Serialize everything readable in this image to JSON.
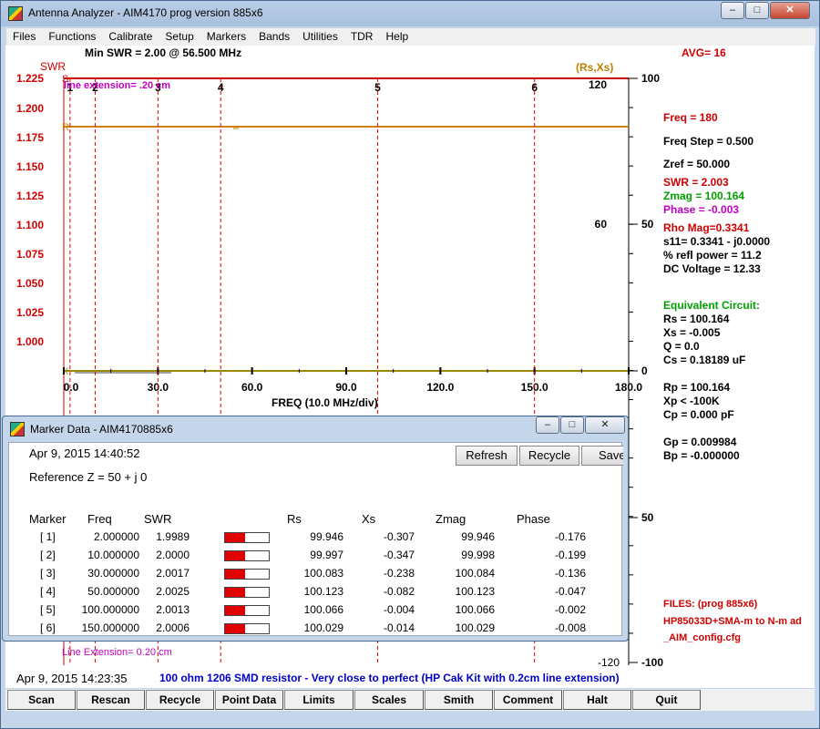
{
  "window": {
    "title": "Antenna Analyzer - AIM4170    prog version 885x6"
  },
  "menu": [
    "Files",
    "Functions",
    "Calibrate",
    "Setup",
    "Markers",
    "Bands",
    "Utilities",
    "TDR",
    "Help"
  ],
  "header": {
    "min_swr": "Min SWR =   2.00 @  56.500 MHz",
    "avg": "AVG=  16",
    "swr_label": "SWR",
    "rsxs_label": "(Rs,Xs)"
  },
  "chart_data": {
    "type": "line",
    "xlabel": "FREQ (10.0 MHz/div)",
    "x_ticks": [
      "0.0",
      "30.0",
      "60.0",
      "90.0",
      "120.0",
      "150.0",
      "180.0"
    ],
    "xlim": [
      0,
      180
    ],
    "swr_ticks": [
      "1.225",
      "1.200",
      "1.175",
      "1.150",
      "1.125",
      "1.100",
      "1.075",
      "1.050",
      "1.025",
      "1.000"
    ],
    "rs_ticks": [
      "120",
      "60"
    ],
    "xs_ticks": [
      "100",
      "50",
      "0",
      "50",
      "-100"
    ],
    "xs_bottom_tick": "-120",
    "markers": [
      "1",
      "2",
      "3",
      "4",
      "5",
      "6"
    ],
    "marker_freqs": [
      2,
      10,
      30,
      50,
      100,
      150
    ],
    "series": [
      {
        "name": "S",
        "values": [
          2.0,
          2.0
        ]
      },
      {
        "name": "R",
        "values": [
          100.0,
          100.0
        ]
      },
      {
        "name": "X",
        "values": [
          0,
          0
        ]
      }
    ],
    "line_extension_top": "line extension=  .20 cm",
    "line_extension_bottom": "Line Extension= 0.20 cm"
  },
  "side": {
    "freq": "Freq = 180",
    "freq_step": "Freq Step = 0.500",
    "zref": "Zref =   50.000",
    "swr": "SWR  =   2.003",
    "zmag": "Zmag = 100.164",
    "phase": "Phase =  -0.003",
    "rho": "Rho Mag=0.3341",
    "s11": "s11= 0.3341 - j0.0000",
    "refl": "% refl power = 11.2",
    "dcv": "DC Voltage  =  12.33",
    "eq_title": "Equivalent Circuit:",
    "rs": "Rs =  100.164",
    "xs": "Xs =  -0.005",
    "q": "Q =  0.0",
    "cs": "Cs =   0.18189  uF",
    "rp": "Rp =  100.164",
    "xp": "Xp < -100K",
    "cp": "Cp =     0.000  pF",
    "gp": "Gp =  0.009984",
    "bp": "Bp = -0.000000",
    "files_title": "FILES:  (prog 885x6)",
    "file1": "HP85033D+SMA-m to N-m ad",
    "file2": "_AIM_config.cfg"
  },
  "status": {
    "datetime": "Apr 9, 2015   14:23:35",
    "comment": "100 ohm 1206 SMD resistor - Very close to perfect (HP Cak Kit with 0.2cm line extension)"
  },
  "buttons": [
    "Scan",
    "Rescan",
    "Recycle",
    "Point Data",
    "Limits",
    "Scales",
    "Smith",
    "Comment",
    "Halt",
    "Quit"
  ],
  "dialog": {
    "title": "Marker Data -  AIM4170885x6",
    "datetime": "Apr 9, 2015   14:40:52",
    "refz": "Reference Z = 50   + j 0",
    "btn_refresh": "Refresh",
    "btn_recycle": "Recycle",
    "btn_save": "Save",
    "headers": [
      "Marker",
      "Freq",
      "SWR",
      "Rs",
      "Xs",
      "Zmag",
      "Phase"
    ],
    "rows": [
      {
        "m": "[ 1]",
        "f": "2.000000",
        "swr": "1.9989",
        "rs": "99.946",
        "xs": "-0.307",
        "zmag": "99.946",
        "ph": "-0.176",
        "bar": 0.45
      },
      {
        "m": "[ 2]",
        "f": "10.000000",
        "swr": "2.0000",
        "rs": "99.997",
        "xs": "-0.347",
        "zmag": "99.998",
        "ph": "-0.199",
        "bar": 0.45
      },
      {
        "m": "[ 3]",
        "f": "30.000000",
        "swr": "2.0017",
        "rs": "100.083",
        "xs": "-0.238",
        "zmag": "100.084",
        "ph": "-0.136",
        "bar": 0.45
      },
      {
        "m": "[ 4]",
        "f": "50.000000",
        "swr": "2.0025",
        "rs": "100.123",
        "xs": "-0.082",
        "zmag": "100.123",
        "ph": "-0.047",
        "bar": 0.45
      },
      {
        "m": "[ 5]",
        "f": "100.000000",
        "swr": "2.0013",
        "rs": "100.066",
        "xs": "-0.004",
        "zmag": "100.066",
        "ph": "-0.002",
        "bar": 0.45
      },
      {
        "m": "[ 6]",
        "f": "150.000000",
        "swr": "2.0006",
        "rs": "100.029",
        "xs": "-0.014",
        "zmag": "100.029",
        "ph": "-0.008",
        "bar": 0.45
      }
    ]
  },
  "colors": {
    "swr": "#d00000",
    "rs": "#d08000",
    "xs": "#9a8a00",
    "marker": "#e00000",
    "axis": "#000000"
  }
}
